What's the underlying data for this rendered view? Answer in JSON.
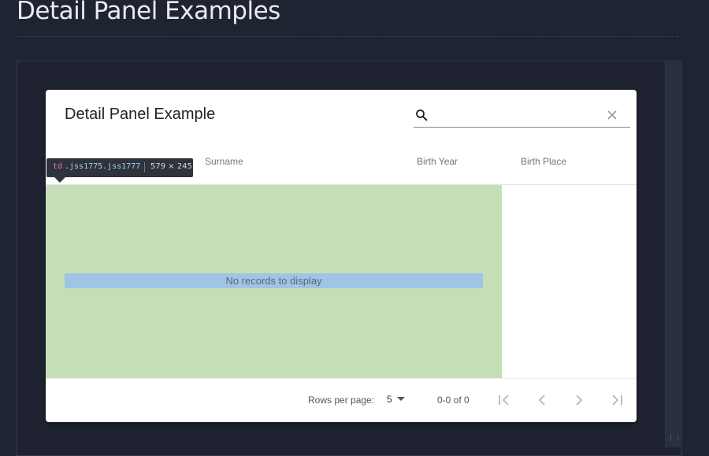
{
  "page": {
    "title": "Detail Panel Examples"
  },
  "table": {
    "title": "Detail Panel Example",
    "search": {
      "value": "",
      "placeholder": ""
    },
    "columns": [
      "",
      "Surname",
      "Birth Year",
      "Birth Place"
    ],
    "rows": [],
    "empty_message": "No records to display"
  },
  "pagination": {
    "rows_per_page_label": "Rows per page:",
    "rows_per_page_value": "5",
    "page_info": "0-0 of 0"
  },
  "inspector_tooltip": {
    "tag": "td",
    "classes": ".jss1775.jss1777",
    "dimensions": "579 × 245"
  },
  "colors": {
    "background": "#1f2432",
    "card": "#ffffff",
    "highlight_content": "#c5deb7",
    "highlight_padding": "#a0c4e6"
  },
  "icons": [
    "search-icon",
    "clear-icon",
    "dropdown-arrow-icon",
    "first-page-icon",
    "previous-page-icon",
    "next-page-icon",
    "last-page-icon"
  ]
}
